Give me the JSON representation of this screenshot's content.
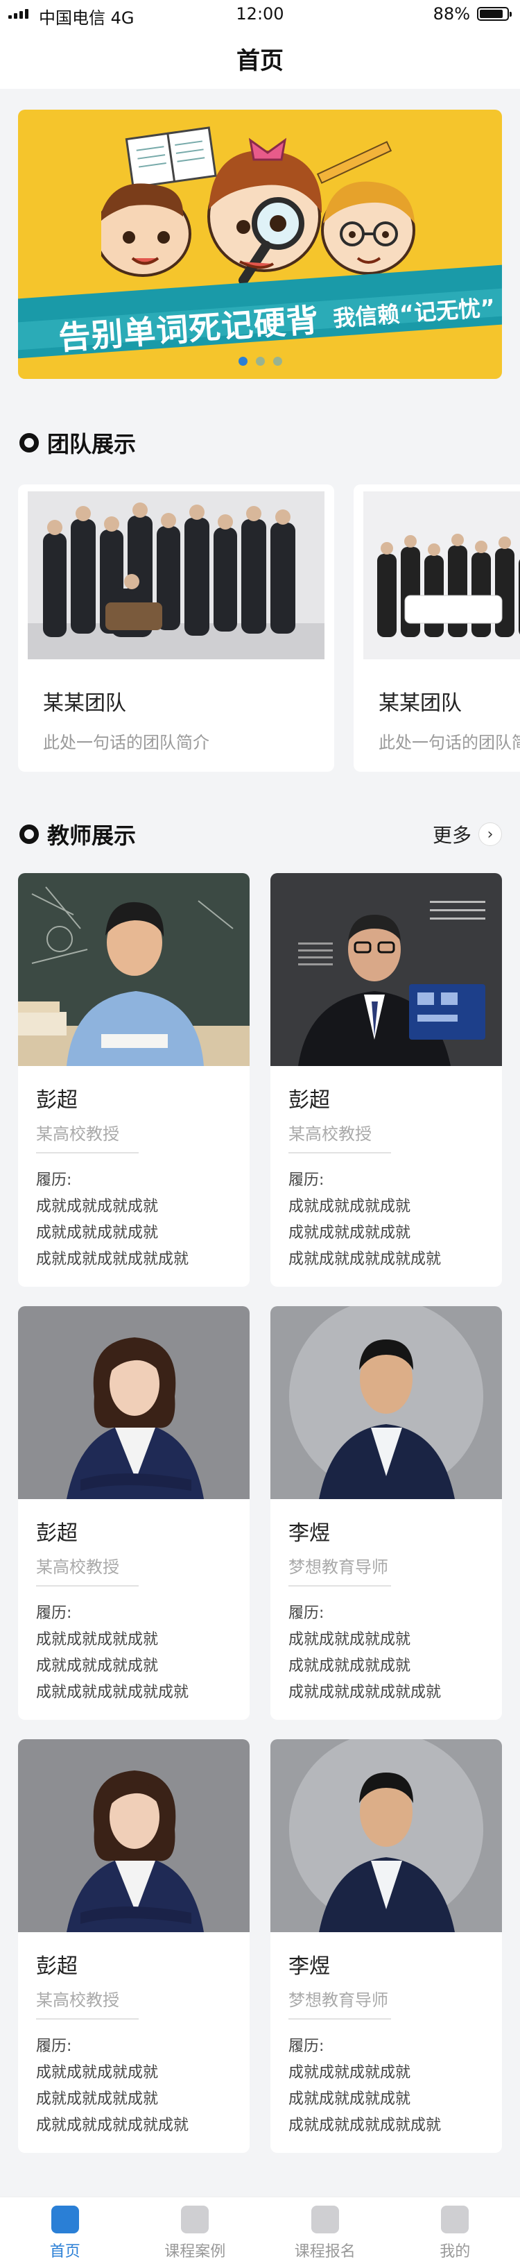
{
  "status_bar": {
    "carrier": "中国电信  4G",
    "time": "12:00",
    "battery": "88%",
    "battery_level": 0.88
  },
  "nav": {
    "title": "首页"
  },
  "banner": {
    "slogan_left": "告别单词死记硬背",
    "slogan_right": "我信赖“记无忧”",
    "dot_count": 3,
    "active_dot": 0
  },
  "team_section": {
    "title": "团队展示",
    "cards": [
      {
        "name": "某某团队",
        "desc": "此处一句话的团队简介"
      },
      {
        "name": "某某团队",
        "desc": "此处一句话的团队简介"
      }
    ]
  },
  "teacher_section": {
    "title": "教师展示",
    "more": "更多",
    "resume_label": "履历:",
    "teachers": [
      {
        "name": "彭超",
        "title": "某高校教授",
        "resume": [
          "成就成就成就成就",
          "成就成就成就成就",
          "成就成就成就成就成就"
        ],
        "photo": "classroom-teacher"
      },
      {
        "name": "彭超",
        "title": "某高校教授",
        "resume": [
          "成就成就成就成就",
          "成就成就成就成就",
          "成就成就成就成就成就"
        ],
        "photo": "speaker-with-board"
      },
      {
        "name": "彭超",
        "title": "某高校教授",
        "resume": [
          "成就成就成就成就",
          "成就成就成就成就",
          "成就成就成就成就成就"
        ],
        "photo": "woman-portrait"
      },
      {
        "name": "李煜",
        "title": "梦想教育导师",
        "resume": [
          "成就成就成就成就",
          "成就成就成就成就",
          "成就成就成就成就成就"
        ],
        "photo": "man-portrait"
      },
      {
        "name": "彭超",
        "title": "某高校教授",
        "resume": [
          "成就成就成就成就",
          "成就成就成就成就",
          "成就成就成就成就成就"
        ],
        "photo": "woman-portrait"
      },
      {
        "name": "李煜",
        "title": "梦想教育导师",
        "resume": [
          "成就成就成就成就",
          "成就成就成就成就",
          "成就成就成就成就成就"
        ],
        "photo": "man-portrait"
      }
    ]
  },
  "tab_bar": {
    "active": 0,
    "tabs": [
      {
        "label": "首页",
        "icon": "home-icon"
      },
      {
        "label": "课程案例",
        "icon": "case-icon"
      },
      {
        "label": "课程报名",
        "icon": "signup-icon"
      },
      {
        "label": "我的",
        "icon": "profile-icon"
      }
    ]
  }
}
